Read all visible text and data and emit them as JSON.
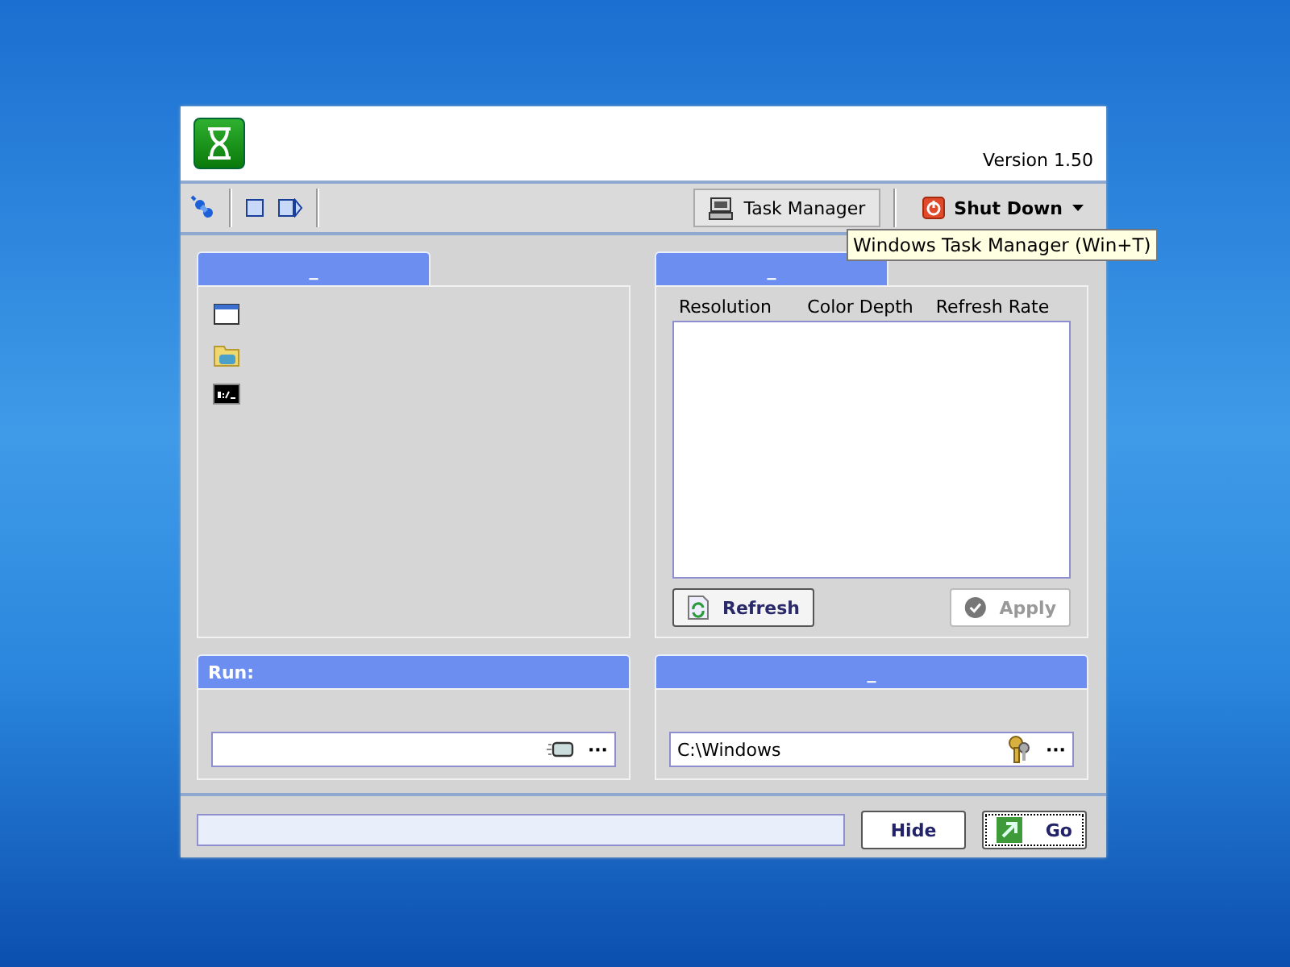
{
  "header": {
    "version": "Version 1.50"
  },
  "toolbar": {
    "task_manager": {
      "label": "Task Manager",
      "hovered": true
    },
    "shut_down": {
      "label": "Shut Down"
    }
  },
  "tooltip": {
    "text": "Windows Task Manager (Win+T)"
  },
  "shortcuts_panel": {
    "title": "_"
  },
  "display_panel": {
    "title": "_",
    "columns": [
      "Resolution",
      "Color Depth",
      "Refresh Rate"
    ],
    "buttons": [
      {
        "kind": "refresh",
        "label": "Refresh",
        "disabled": false
      },
      {
        "kind": "apply",
        "label": "Apply",
        "disabled": true
      }
    ]
  },
  "run_panel": {
    "title": "Run:",
    "browse": "···"
  },
  "folder_panel": {
    "title": "_",
    "value": "C:\\Windows",
    "browse": "···"
  },
  "bottom_bar": {
    "buttons": [
      {
        "kind": "hide",
        "label": "Hide",
        "selected": false
      },
      {
        "kind": "go",
        "label": "Go",
        "selected": true
      }
    ]
  }
}
